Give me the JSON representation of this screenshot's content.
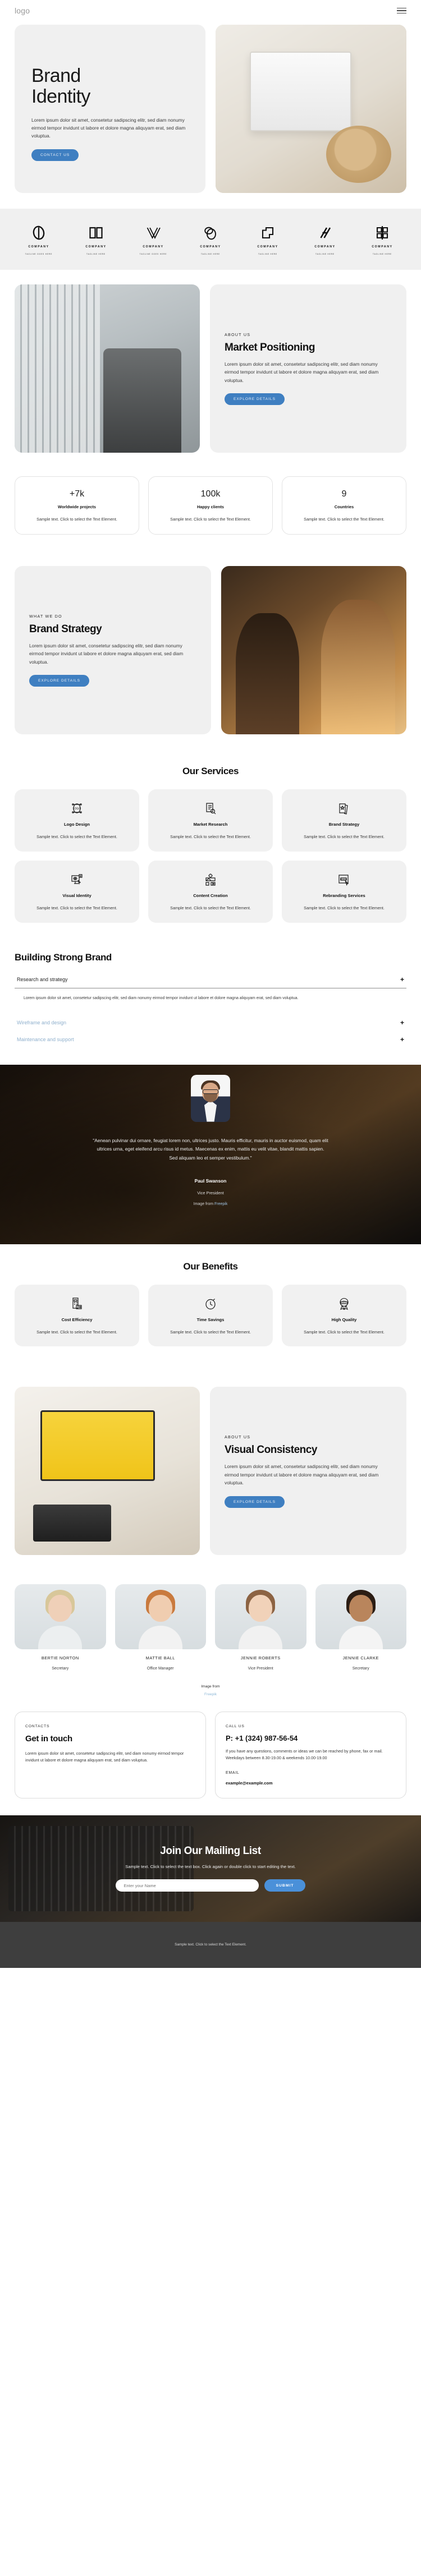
{
  "header": {
    "logo": "logo",
    "menu_icon": "hamburger-menu-icon"
  },
  "hero": {
    "title_line1": "Brand",
    "title_line2": "Identity",
    "paragraph": "Lorem ipsum dolor sit amet, consetetur sadipscing elitr, sed diam nonumy eirmod tempor invidunt ut labore et dolore magna aliquyam erat, sed diam voluptua.",
    "cta": "CONTACT US"
  },
  "logos": [
    {
      "company": "COMPANY",
      "tagline": "TAGLINE GOES HERE"
    },
    {
      "company": "COMPANY",
      "tagline": "TAGLINE HERE"
    },
    {
      "company": "COMPANY",
      "tagline": "TAGLINE GOES HERE"
    },
    {
      "company": "COMPANY",
      "tagline": "TAGLINE HERE"
    },
    {
      "company": "COMPANY",
      "tagline": "TAGLINE HERE"
    },
    {
      "company": "COMPANY",
      "tagline": "TAGLINE HERE"
    },
    {
      "company": "COMPANY",
      "tagline": "TAGLINE HERE"
    }
  ],
  "market": {
    "eyebrow": "ABOUT US",
    "title": "Market Positioning",
    "paragraph": "Lorem ipsum dolor sit amet, consetetur sadipscing elitr, sed diam nonumy eirmod tempor invidunt ut labore et dolore magna aliquyam erat, sed diam voluptua.",
    "cta": "EXPLORE DETAILS"
  },
  "stats": [
    {
      "number": "+7k",
      "label": "Worldwide projects",
      "text": "Sample text. Click to select the Text Element."
    },
    {
      "number": "100k",
      "label": "Happy clients",
      "text": "Sample text. Click to select the Text Element."
    },
    {
      "number": "9",
      "label": "Countries",
      "text": "Sample text. Click to select the Text Element."
    }
  ],
  "strategy": {
    "eyebrow": "WHAT WE DO",
    "title": "Brand Strategy",
    "paragraph": "Lorem ipsum dolor sit amet, consetetur sadipscing elitr, sed diam nonumy eirmod tempor invidunt ut labore et dolore magna aliquyam erat, sed diam voluptua.",
    "cta": "EXPLORE DETAILS"
  },
  "services": {
    "title": "Our Services",
    "items": [
      {
        "icon": "logo-design-icon",
        "title": "Logo Design",
        "text": "Sample text. Click to select the Text Element."
      },
      {
        "icon": "market-research-icon",
        "title": "Market Research",
        "text": "Sample text. Click to select the Text Element."
      },
      {
        "icon": "brand-strategy-icon",
        "title": "Brand Strategy",
        "text": "Sample text. Click to select the Text Element."
      },
      {
        "icon": "visual-identity-icon",
        "title": "Visual Identity",
        "text": "Sample text. Click to select the Text Element."
      },
      {
        "icon": "content-creation-icon",
        "title": "Content Creation",
        "text": "Sample text. Click to select the Text Element."
      },
      {
        "icon": "rebranding-icon",
        "title": "Rebranding Services",
        "text": "Sample text. Click to select the Text Element."
      }
    ]
  },
  "accordion": {
    "title": "Building Strong Brand",
    "items": [
      {
        "label": "Research and strategy",
        "state": "open",
        "plus": "+",
        "body": "Lorem ipsum dolor sit amet, consetetur sadipscing elitr, sed diam nonumy eirmod tempor invidunt ut labore et dolore magna aliquyam erat, sed diam voluptua."
      },
      {
        "label": "Wireframe and design",
        "state": "closed",
        "plus": "+",
        "body": ""
      },
      {
        "label": "Maintenance and support",
        "state": "closed",
        "plus": "+",
        "body": ""
      }
    ]
  },
  "testimonial": {
    "quote": "\"Aenean pulvinar dui ornare, feugiat lorem non, ultrices justo. Mauris efficitur, mauris in auctor euismod, quam elit ultrices urna, eget eleifend arcu risus id metus. Maecenas ex enim, mattis eu velit vitae, blandit mattis sapien. Sed aliquam leo et semper vestibulum.\"",
    "name": "Paul Swanson",
    "role": "Vice President",
    "credit_prefix": "Image from ",
    "credit_link": "Freepik"
  },
  "benefits": {
    "title": "Our Benefits",
    "items": [
      {
        "icon": "cost-efficiency-icon",
        "title": "Cost Efficiency",
        "text": "Sample text. Click to select the Text Element."
      },
      {
        "icon": "time-savings-icon",
        "title": "Time Savings",
        "text": "Sample text. Click to select the Text Element."
      },
      {
        "icon": "high-quality-icon",
        "title": "High Quality",
        "text": "Sample text. Click to select the Text Element."
      }
    ]
  },
  "visual": {
    "eyebrow": "ABOUT US",
    "title": "Visual Consistency",
    "paragraph": "Lorem ipsum dolor sit amet, consetetur sadipscing elitr, sed diam nonumy eirmod tempor invidunt ut labore et dolore magna aliquyam erat, sed diam voluptua.",
    "cta": "EXPLORE DETAILS"
  },
  "team": {
    "members": [
      {
        "name": "BERTIE NORTON",
        "role": "Secretary"
      },
      {
        "name": "MATTIE BALL",
        "role": "Office Manager"
      },
      {
        "name": "JENNIE ROBERTS",
        "role": "Vice President"
      },
      {
        "name": "JENNIE CLARKE",
        "role": "Secretary"
      }
    ],
    "credit_prefix": "Image from",
    "credit_link": "Freepik"
  },
  "contacts": {
    "left": {
      "eyebrow": "CONTACTS",
      "title": "Get in touch",
      "text": "Lorem ipsum dolor sit amet, consetetur sadipscing elitr, sed diam nonumy eirmod tempor invidunt ut labore et dolore magna aliquyam erat, sed diam voluptua."
    },
    "right": {
      "eyebrow": "CALL US",
      "phone": "P: +1 (324) 987-56-54",
      "hours": "If you have any questions, comments or ideas we can be reached by phone, fax or mail. Weekdays between 8.30-19.00 & weekends 10.00-19.00",
      "email_label": "EMAIL",
      "email": "example@example.com"
    }
  },
  "mailing": {
    "title": "Join Our Mailing List",
    "subtitle": "Sample text. Click to select the text box. Click again or double click to start editing the text.",
    "input_placeholder": "Enter your Name",
    "submit": "SUBMIT"
  },
  "footer": {
    "text": "Sample text. Click to select the Text Element."
  },
  "theme": {
    "accent": "#3f7fc1",
    "card_bg": "#f0f0f0",
    "footer_bg": "#3e3e3e",
    "link": "#8fb9d8"
  }
}
